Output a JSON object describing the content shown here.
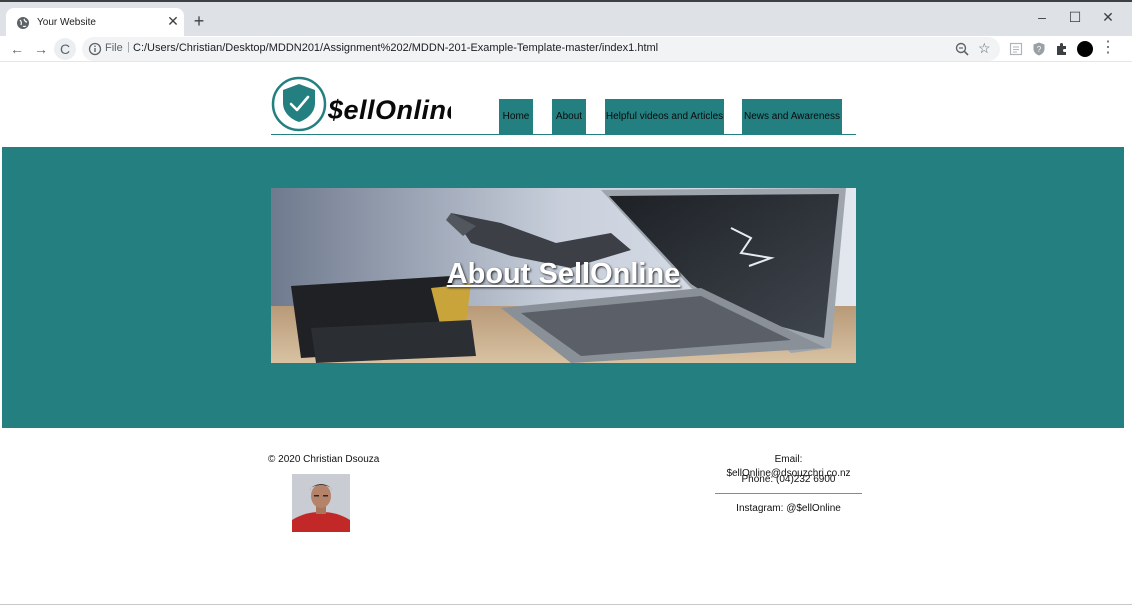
{
  "browser": {
    "tab_title": "Your Website",
    "tab_close": "✕",
    "new_tab": "+",
    "window_controls": {
      "minimize": "–",
      "maximize": "☐",
      "close": "✕"
    },
    "back": "←",
    "forward": "→",
    "reload": "C",
    "address": {
      "scheme_label": "File",
      "separator": "|",
      "url": "C:/Users/Christian/Desktop/MDDN201/Assignment%202/MDDN-201-Example-Template-master/index1.html"
    },
    "star": "☆",
    "menu": "⋮",
    "icons": [
      "globe-icon",
      "info-icon",
      "zoom-icon",
      "star-icon",
      "reader-icon",
      "shield-extension-icon",
      "puzzle-icon",
      "profile-avatar-icon",
      "menu-icon"
    ]
  },
  "site": {
    "logo_text": "$ellOnline",
    "brand_color": "#237f80",
    "nav": [
      {
        "label": "Home"
      },
      {
        "label": "About"
      },
      {
        "label": "Helpful videos and Articles"
      },
      {
        "label": "News and Awareness"
      }
    ],
    "hero_title": "About SellOnline",
    "footer": {
      "copyright": "© 2020 Christian Dsouza",
      "email": "Email: $ellOnline@dsouzchri.co.nz",
      "phone": "Phone: (04)232 6900",
      "instagram": "Instagram: @$ellOnline"
    }
  }
}
